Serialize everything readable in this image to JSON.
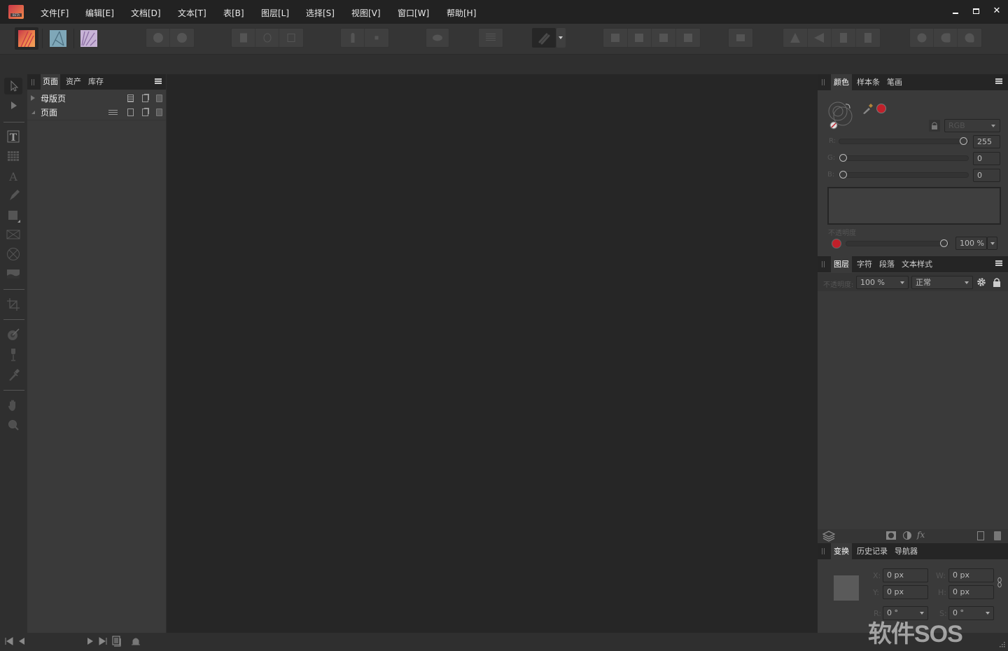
{
  "app": {
    "logo_badge": "BETA",
    "menu": [
      "文件[F]",
      "编辑[E]",
      "文档[D]",
      "文本[T]",
      "表[B]",
      "图层[L]",
      "选择[S]",
      "视图[V]",
      "窗口[W]",
      "帮助[H]"
    ],
    "window_controls": {
      "minimize": "—",
      "maximize": "□",
      "close": "✕"
    }
  },
  "toolbar": {
    "personas": [
      {
        "name": "publisher-persona",
        "color": "#e8734a",
        "active": true
      },
      {
        "name": "designer-persona",
        "color": "#7fa7b8",
        "active": false
      },
      {
        "name": "photo-persona",
        "color": "#b79ec8",
        "active": false
      }
    ]
  },
  "pages_panel": {
    "tabs": [
      {
        "label": "页面",
        "active": true
      },
      {
        "label": "资产",
        "active": false
      },
      {
        "label": "库存",
        "active": false
      }
    ],
    "rows": [
      {
        "label": "母版页",
        "expanded": false
      },
      {
        "label": "页面",
        "expanded": true
      }
    ]
  },
  "color_panel": {
    "tabs": [
      {
        "label": "颜色",
        "active": true
      },
      {
        "label": "样本条",
        "active": false
      },
      {
        "label": "笔画",
        "active": false
      }
    ],
    "current_color": "#c0202a",
    "model": "RGB",
    "channels": [
      {
        "label": "R:",
        "value": "255",
        "fraction": 1.0
      },
      {
        "label": "G:",
        "value": "0",
        "fraction": 0.0
      },
      {
        "label": "B:",
        "value": "0",
        "fraction": 0.0
      }
    ],
    "opacity_label": "不透明度",
    "opacity_value": "100 %",
    "opacity_fraction": 1.0
  },
  "layers_panel": {
    "tabs": [
      {
        "label": "图层",
        "active": true
      },
      {
        "label": "字符",
        "active": false
      },
      {
        "label": "段落",
        "active": false
      },
      {
        "label": "文本样式",
        "active": false
      }
    ],
    "opacity_label": "不透明度:",
    "opacity_value": "100 %",
    "blend_mode": "正常"
  },
  "transform_panel": {
    "tabs": [
      {
        "label": "变换",
        "active": true
      },
      {
        "label": "历史记录",
        "active": false
      },
      {
        "label": "导航器",
        "active": false
      }
    ],
    "fields": {
      "x": {
        "label": "X:",
        "value": "0 px"
      },
      "y": {
        "label": "Y:",
        "value": "0 px"
      },
      "w": {
        "label": "W:",
        "value": "0 px"
      },
      "h": {
        "label": "H:",
        "value": "0 px"
      },
      "r": {
        "label": "R:",
        "value": "0 °"
      },
      "s": {
        "label": "S:",
        "value": "0 °"
      }
    }
  },
  "watermark": "软件SOS"
}
